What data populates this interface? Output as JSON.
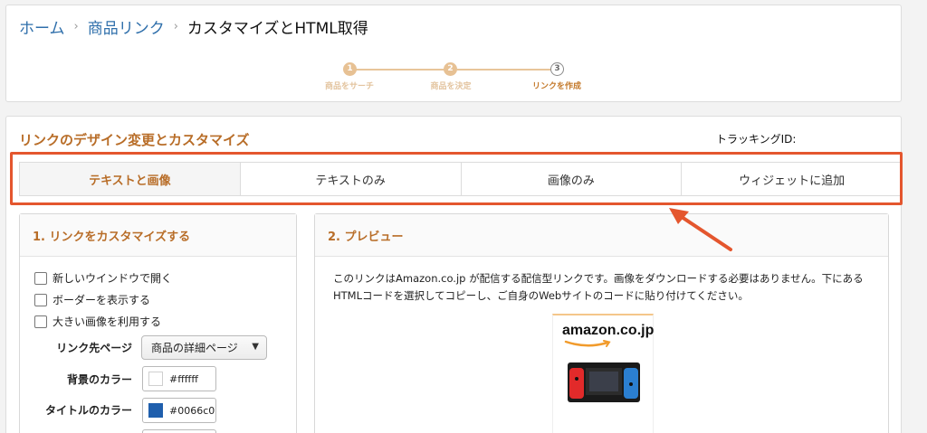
{
  "breadcrumb": {
    "home": "ホーム",
    "links": "商品リンク",
    "current": "カスタマイズとHTML取得",
    "separator": "›"
  },
  "steps": [
    {
      "num": "1",
      "label": "商品をサーチ"
    },
    {
      "num": "2",
      "label": "商品を決定"
    },
    {
      "num": "3",
      "label": "リンクを作成"
    }
  ],
  "section": {
    "title": "リンクのデザイン変更とカスタマイズ",
    "tracking_label": "トラッキングID:"
  },
  "tabs": [
    "テキストと画像",
    "テキストのみ",
    "画像のみ",
    "ウィジェットに追加"
  ],
  "customize": {
    "title": "1. リンクをカスタマイズする",
    "checkboxes": [
      "新しいウインドウで開く",
      "ボーダーを表示する",
      "大きい画像を利用する"
    ],
    "link_dest_label": "リンク先ページ",
    "link_dest_value": "商品の詳細ページ",
    "bg_color_label": "背景のカラー",
    "bg_color_value": "#ffffff",
    "title_color_label": "タイトルのカラー",
    "title_color_value": "#0066c0"
  },
  "preview": {
    "title": "2. プレビュー",
    "text": "このリンクはAmazon.co.jp が配信する配信型リンクです。画像をダウンロードする必要はありません。下にあるHTMLコードを選択してコピーし、ご自身のWebサイトのコードに貼り付けてください。",
    "logo_text": "amazon.co.jp"
  },
  "colors": {
    "accent": "#b86d28",
    "link": "#2f6fab",
    "highlight": "#e4562e"
  }
}
